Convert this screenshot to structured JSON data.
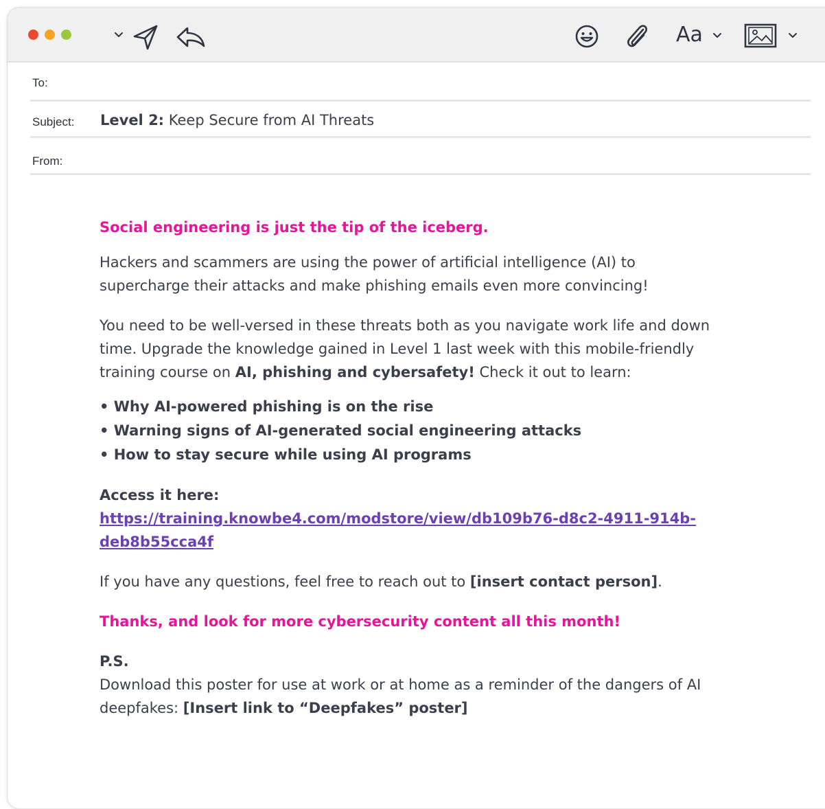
{
  "colors": {
    "dot_red": "#ec4a2c",
    "dot_orange": "#f5a421",
    "dot_green": "#9bc83a",
    "accent_pink": "#e6159a",
    "link_purple": "#6c3fb3"
  },
  "toolbar": {
    "window_controls": [
      "close-dot",
      "minimize-dot",
      "zoom-dot"
    ],
    "icons": [
      "chevron-down-icon",
      "send-icon",
      "reply-icon",
      "emoji-icon",
      "paperclip-icon",
      "image-icon"
    ],
    "font_label": "Aa"
  },
  "header": {
    "to_label": "To:",
    "subject_label": "Subject:",
    "subject_bold": "Level 2:",
    "subject_rest": " Keep Secure from AI Threats",
    "from_label": "From:"
  },
  "body": {
    "headline": "Social engineering is just the tip of the iceberg.",
    "para1": "Hackers and scammers are using the power of artificial intelligence (AI) to supercharge their attacks and make phishing emails even more convincing!",
    "para2_start": "You need to be well-versed in these threats both as you navigate work life and down time. Upgrade the knowledge gained in Level 1 last week with this mobile-friendly training course on ",
    "para2_bold": "AI, phishing and cybersafety!",
    "para2_end": " Check it out to learn:",
    "bullets": [
      "• Why AI-powered phishing is on the rise",
      "• Warning signs of AI-generated social engineering attacks",
      "• How to stay secure while using AI programs"
    ],
    "access_label": "Access it here:",
    "access_link_line1": "https://training.knowbe4.com/modstore/view/db109b76-d8c2-4911-914b-",
    "access_link_line2": "deb8b55cca4f",
    "questions_start": "If you have any questions, feel free to reach out to ",
    "questions_bold": "[insert contact person]",
    "questions_end": ".",
    "thanks": "Thanks, and look for more cybersecurity content all this month!",
    "ps_label": "P.S.",
    "ps_text_start": "Download this poster for use at work or at home as a reminder of the dangers of AI deepfakes: ",
    "ps_text_bold": "[Insert link to “Deepfakes” poster]"
  }
}
